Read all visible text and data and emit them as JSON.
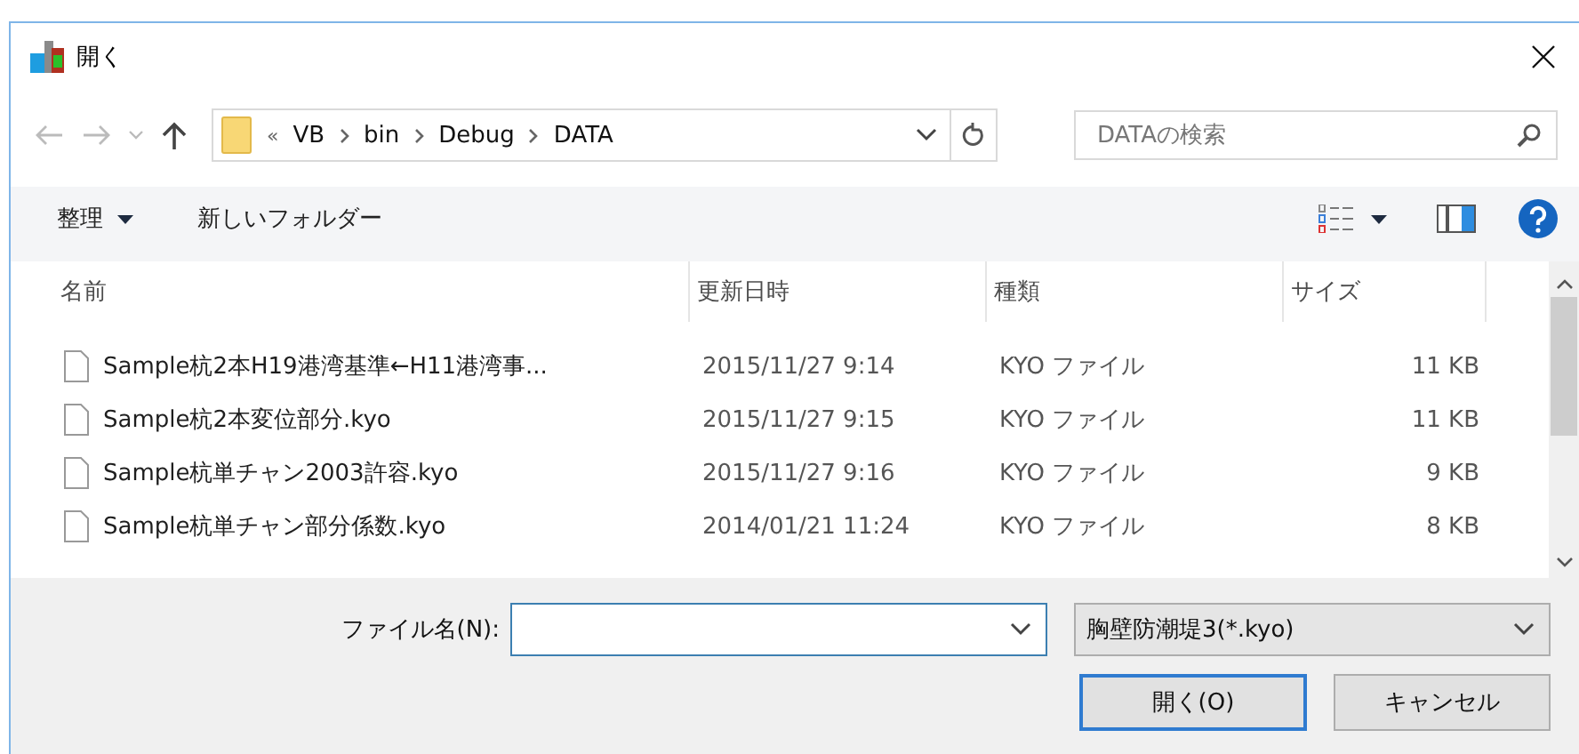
{
  "window": {
    "title": "開く"
  },
  "address": {
    "overflow": "«",
    "crumbs": [
      "VB",
      "bin",
      "Debug",
      "DATA"
    ]
  },
  "search": {
    "placeholder": "DATAの検索"
  },
  "toolbar": {
    "organize": "整理",
    "new_folder": "新しいフォルダー"
  },
  "columns": [
    "名前",
    "更新日時",
    "種類",
    "サイズ"
  ],
  "files": [
    {
      "name": "Sample杭2本H19港湾基準←H11港湾事...",
      "date": "2015/11/27 9:14",
      "type": "KYO ファイル",
      "size": "11 KB"
    },
    {
      "name": "Sample杭2本変位部分.kyo",
      "date": "2015/11/27 9:15",
      "type": "KYO ファイル",
      "size": "11 KB"
    },
    {
      "name": "Sample杭単チャン2003許容.kyo",
      "date": "2015/11/27 9:16",
      "type": "KYO ファイル",
      "size": "9 KB"
    },
    {
      "name": "Sample杭単チャン部分係数.kyo",
      "date": "2014/01/21 11:24",
      "type": "KYO ファイル",
      "size": "8 KB"
    }
  ],
  "filename": {
    "label": "ファイル名(N):"
  },
  "filter": {
    "value": "胸壁防潮堤3(*.kyo)"
  },
  "buttons": [
    {
      "label": "開く(O)",
      "default": true
    },
    {
      "label": "キャンセル",
      "default": false
    }
  ]
}
